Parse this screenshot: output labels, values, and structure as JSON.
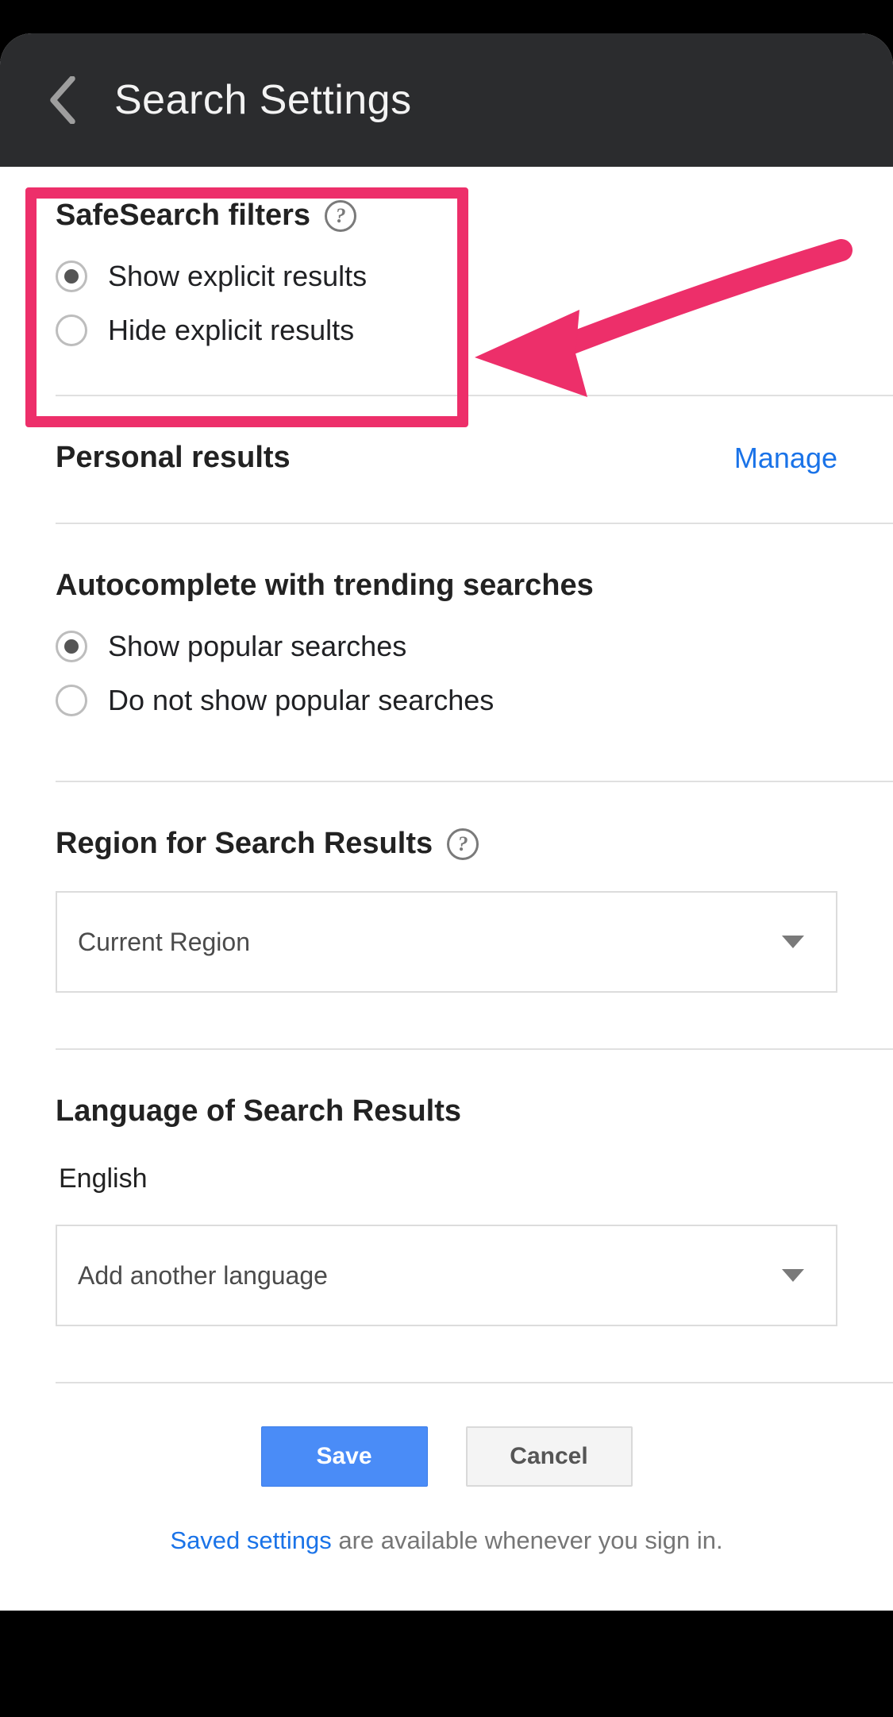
{
  "header": {
    "title": "Search Settings"
  },
  "safesearch": {
    "title": "SafeSearch filters",
    "option_show": "Show explicit results",
    "option_hide": "Hide explicit results",
    "selected": "show"
  },
  "personal": {
    "title": "Personal results",
    "manage": "Manage"
  },
  "autocomplete": {
    "title": "Autocomplete with trending searches",
    "option_show": "Show popular searches",
    "option_hide": "Do not show popular searches",
    "selected": "show"
  },
  "region": {
    "title": "Region for Search Results",
    "selected": "Current Region"
  },
  "language": {
    "title": "Language of Search Results",
    "current": "English",
    "add_placeholder": "Add another language"
  },
  "buttons": {
    "save": "Save",
    "cancel": "Cancel"
  },
  "footer": {
    "link_text": "Saved settings",
    "rest": " are available whenever you sign in."
  },
  "annotation": {
    "highlight_color": "#ed2f6a"
  }
}
